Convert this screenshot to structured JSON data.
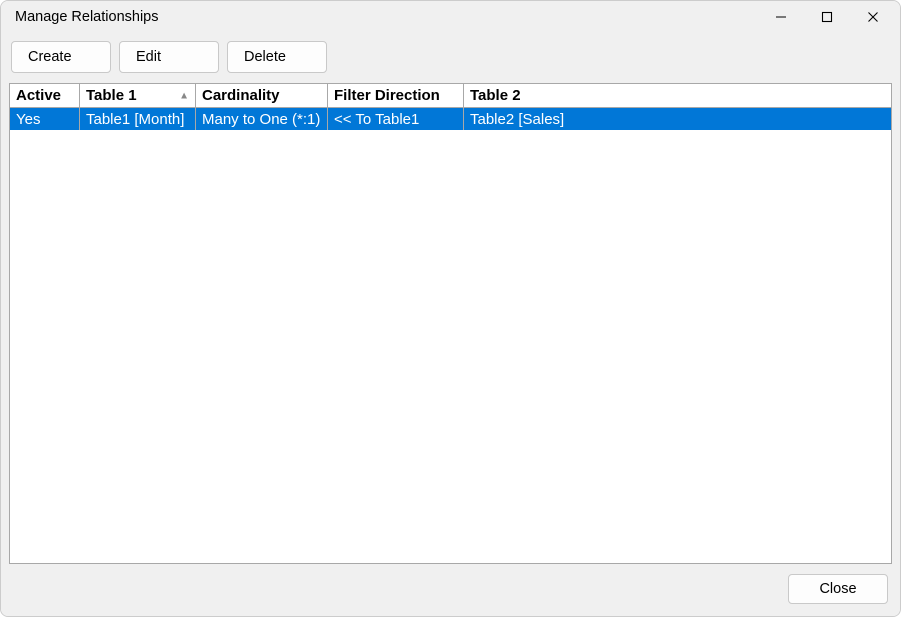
{
  "window": {
    "title": "Manage Relationships"
  },
  "toolbar": {
    "create_label": "Create",
    "edit_label": "Edit",
    "delete_label": "Delete"
  },
  "grid": {
    "headers": {
      "active": "Active",
      "table1": "Table 1",
      "cardinality": "Cardinality",
      "filter_direction": "Filter Direction",
      "table2": "Table 2"
    },
    "sort_column": "table1",
    "rows": [
      {
        "active": "Yes",
        "table1": "Table1 [Month]",
        "cardinality": "Many to One (*:1)",
        "filter_direction": "<< To Table1",
        "table2": "Table2 [Sales]",
        "selected": true
      }
    ]
  },
  "footer": {
    "close_label": "Close"
  }
}
